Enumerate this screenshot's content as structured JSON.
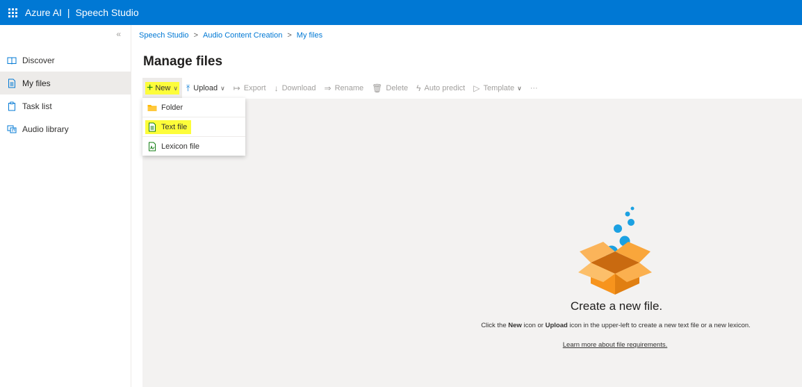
{
  "header": {
    "product": "Azure AI",
    "separator": "|",
    "app_name": "Speech Studio",
    "waffle_icon": "waffle-icon"
  },
  "sidebar": {
    "collapse_glyph": "«",
    "items": [
      {
        "label": "Discover",
        "icon": "book-icon",
        "active": false
      },
      {
        "label": "My files",
        "icon": "document-icon",
        "active": true
      },
      {
        "label": "Task list",
        "icon": "clipboard-icon",
        "active": false
      },
      {
        "label": "Audio library",
        "icon": "audio-library-icon",
        "active": false
      }
    ]
  },
  "breadcrumb": {
    "items": [
      "Speech Studio",
      "Audio Content Creation",
      "My files"
    ],
    "separator": ">"
  },
  "page_title": "Manage files",
  "toolbar": {
    "new": "New",
    "upload": "Upload",
    "export": "Export",
    "download": "Download",
    "rename": "Rename",
    "delete": "Delete",
    "auto_predict": "Auto predict",
    "template": "Template",
    "more": "···"
  },
  "new_menu": {
    "items": [
      {
        "label": "Folder",
        "icon": "folder-icon"
      },
      {
        "label": "Text file",
        "icon": "text-file-icon",
        "highlighted": true
      },
      {
        "label": "Lexicon file",
        "icon": "lexicon-file-icon"
      }
    ]
  },
  "empty_state": {
    "title": "Create a new file.",
    "desc_before": "Click the ",
    "desc_new": "New",
    "desc_mid": " icon or ",
    "desc_upload": "Upload",
    "desc_after": " icon in the upper-left to create a new text file or a new lexicon.",
    "link": "Learn more about file requirements."
  },
  "colors": {
    "brand_blue": "#0078d4",
    "highlight_yellow": "#fdfd3a",
    "box_orange": "#f7941d",
    "bubble_blue": "#1ba1e2"
  }
}
